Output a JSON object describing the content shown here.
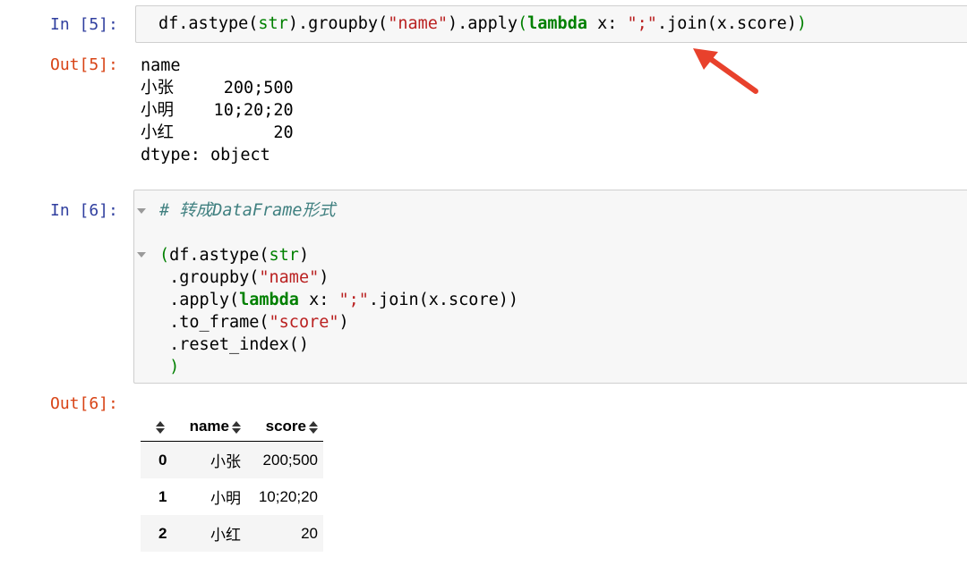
{
  "cells": {
    "in5": {
      "prompt": "In [5]:",
      "code": {
        "p1": "df.astype(",
        "str": "str",
        "p2": ").groupby(",
        "name": "\"name\"",
        "p3": ").apply",
        "paren_open": "(",
        "lambda": "lambda",
        "p4": " x: ",
        "sep": "\";\"",
        "p5": ".join(x.score)",
        "paren_close": ")"
      }
    },
    "out5": {
      "prompt": "Out[5]:",
      "lines": [
        "name",
        "小张     200;500",
        "小明    10;20;20",
        "小红          20",
        "dtype: object"
      ]
    },
    "in6": {
      "prompt": "In [6]:",
      "comment": "# 转成DataFrame形式",
      "code": {
        "l1_open": "(",
        "l1_a": "df.astype(",
        "l1_str": "str",
        "l1_b": ")",
        "l2_a": " .groupby(",
        "l2_str": "\"name\"",
        "l2_b": ")",
        "l3_a": " .apply(",
        "l3_kw": "lambda",
        "l3_b": " x: ",
        "l3_str": "\";\"",
        "l3_c": ".join(x.score))",
        "l4_a": " .to_frame(",
        "l4_str": "\"score\"",
        "l4_b": ")",
        "l5": " .reset_index()",
        "l6_close": " )"
      }
    },
    "out6": {
      "prompt": "Out[6]:",
      "table": {
        "columns": [
          "",
          "name",
          "score"
        ],
        "rows": [
          {
            "index": "0",
            "name": "小张",
            "score": "200;500"
          },
          {
            "index": "1",
            "name": "小明",
            "score": "10;20;20"
          },
          {
            "index": "2",
            "name": "小红",
            "score": "20"
          }
        ]
      }
    }
  },
  "colors": {
    "prompt_in": "#303f9f",
    "prompt_out": "#d84315",
    "keyword": "#008000",
    "string": "#ba2121",
    "comment": "#408080",
    "arrow": "#e8412c"
  }
}
